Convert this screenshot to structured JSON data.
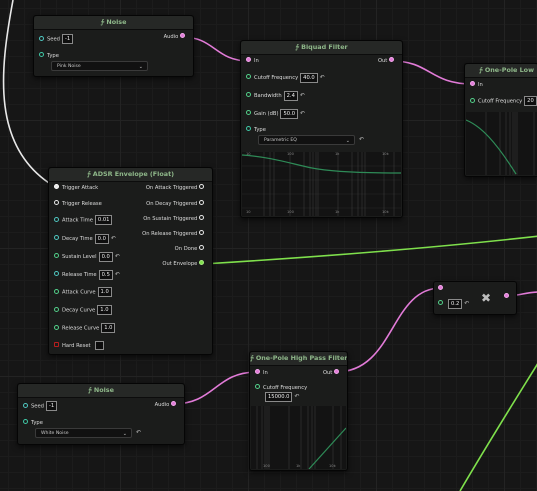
{
  "noise_top": {
    "title": "∱ Noise",
    "seed_label": "Seed",
    "seed_value": "-1",
    "type_label": "Type",
    "type_value": "Pink Noise",
    "out_label": "Audio"
  },
  "biquad": {
    "title": "∱ Biquad Filter",
    "in_label": "In",
    "out_label": "Out",
    "cutoff_label": "Cutoff Frequency",
    "cutoff_value": "40.0",
    "bandwidth_label": "Bandwidth",
    "bandwidth_value": "2.4",
    "gain_label": "Gain (dB)",
    "gain_value": "50.0",
    "type_label": "Type",
    "type_value": "Parametric EQ",
    "plot_labels": [
      "10",
      "100",
      "1k",
      "10k",
      "10",
      "100",
      "1k",
      "10k"
    ]
  },
  "onepole_low": {
    "title": "∱ One-Pole Low",
    "in_label": "In",
    "cutoff_label": "Cutoff Frequency",
    "cutoff_value": "20"
  },
  "adsr": {
    "title": "∱ ADSR Envelope (Float)",
    "inputs": [
      {
        "label": "Trigger Attack"
      },
      {
        "label": "Trigger Release"
      },
      {
        "label": "Attack Time",
        "value": "0.01"
      },
      {
        "label": "Decay Time",
        "value": "0.0"
      },
      {
        "label": "Sustain Level",
        "value": "0.0"
      },
      {
        "label": "Release Time",
        "value": "0.5"
      },
      {
        "label": "Attack Curve",
        "value": "1.0"
      },
      {
        "label": "Decay Curve",
        "value": "1.0"
      },
      {
        "label": "Release Curve",
        "value": "1.0"
      },
      {
        "label": "Hard Reset"
      }
    ],
    "outputs": [
      "On Attack Triggered",
      "On Decay Triggered",
      "On Sustain Triggered",
      "On Release Triggered",
      "On Done",
      "Out Envelope"
    ]
  },
  "multiply": {
    "value": "0.2",
    "symbol": "✖"
  },
  "highpass": {
    "title": "∱ One-Pole High Pass Filter",
    "in_label": "In",
    "out_label": "Out",
    "cutoff_label": "Cutoff Frequency",
    "cutoff_value": "15000.0",
    "plot_labels": [
      "100",
      "1k",
      "10k"
    ]
  },
  "noise_bottom": {
    "title": "∱ Noise",
    "seed_label": "Seed",
    "seed_value": "-1",
    "type_label": "Type",
    "type_value": "White Noise",
    "out_label": "Audio"
  },
  "icons": {
    "reset": "↶",
    "chevron": "⌄"
  },
  "colors": {
    "audio_wire": "#e27bd8",
    "float_wire": "#7fe04c",
    "trigger_wire": "#e8e8e8",
    "title_text": "#8fb88a",
    "plot_curve": "#2e8b57"
  }
}
